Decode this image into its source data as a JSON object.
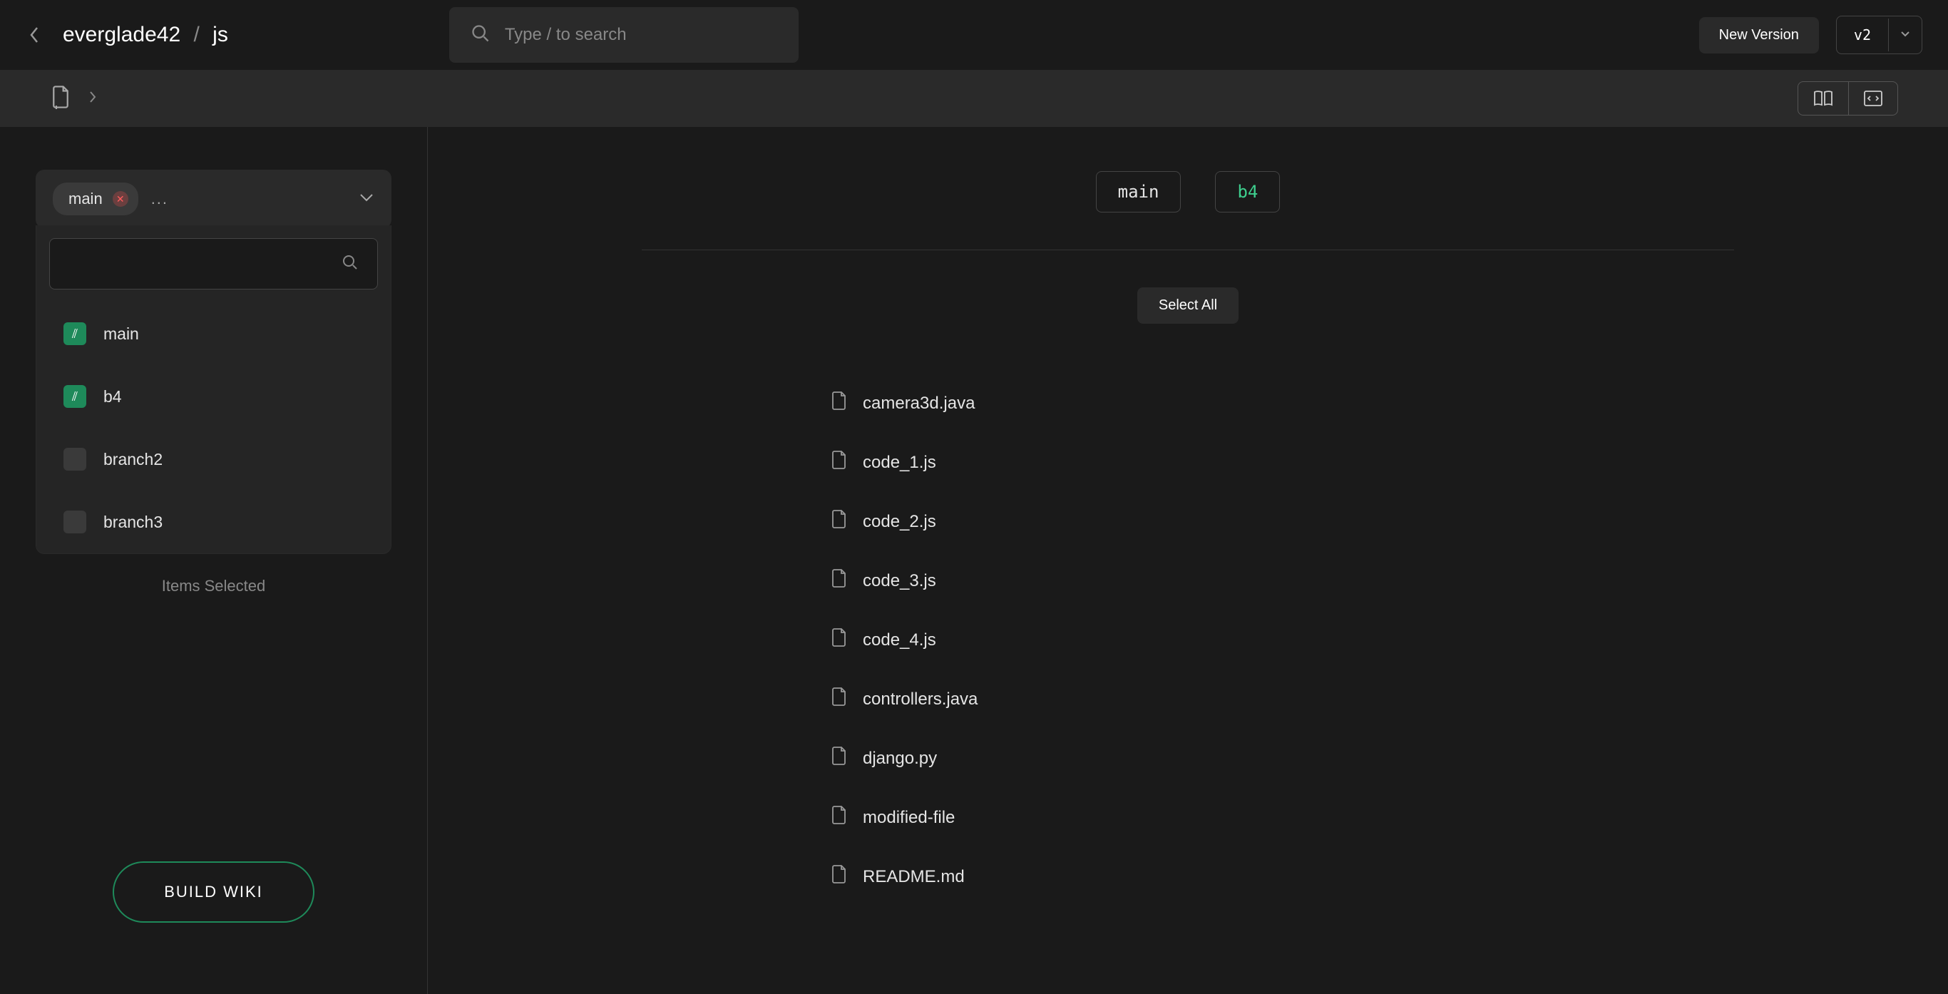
{
  "header": {
    "breadcrumb_owner": "everglade42",
    "breadcrumb_repo": "js",
    "search_placeholder": "Type / to search",
    "new_version_label": "New Version",
    "version_label": "v2"
  },
  "sidebar": {
    "selected_branch": "main",
    "more_indicator": "...",
    "branch_options": [
      {
        "name": "main",
        "checked": true
      },
      {
        "name": "b4",
        "checked": true
      },
      {
        "name": "branch2",
        "checked": false
      },
      {
        "name": "branch3",
        "checked": false
      }
    ],
    "items_selected_label": "Items Selected",
    "build_wiki_label": "BUILD WIKI"
  },
  "content": {
    "branch_pills": [
      {
        "name": "main",
        "active": false
      },
      {
        "name": "b4",
        "active": true
      }
    ],
    "select_all_label": "Select All",
    "files": [
      "camera3d.java",
      "code_1.js",
      "code_2.js",
      "code_3.js",
      "code_4.js",
      "controllers.java",
      "django.py",
      "modified-file",
      "README.md"
    ]
  }
}
